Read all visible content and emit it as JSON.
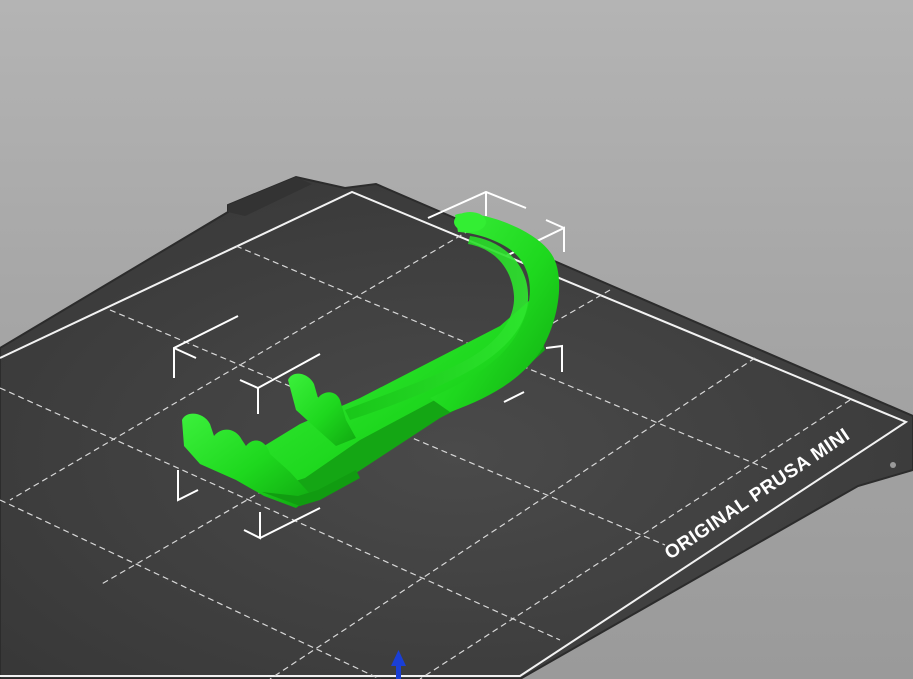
{
  "view": "3D print bed preview",
  "bed": {
    "label": "ORIGINAL PRUSA MINI",
    "surface_color": "#3d3d3d",
    "grid_color": "#d8d8d8",
    "border_color": "#f2f2f2"
  },
  "model": {
    "color": "#22e022",
    "selected": true
  },
  "axis_indicator": {
    "color": "#1a3fd6",
    "icon": "z-axis-arrow-icon"
  },
  "background_color": "#a8a8a8"
}
